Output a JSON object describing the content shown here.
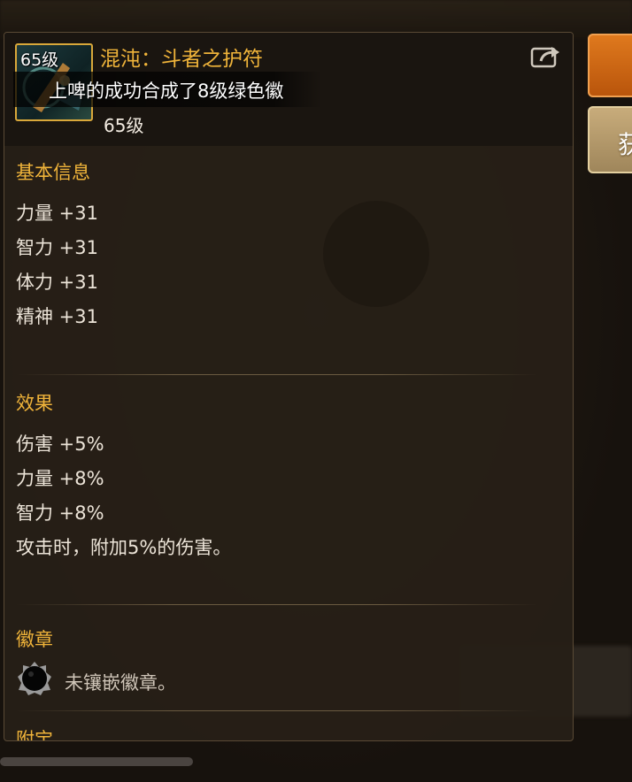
{
  "item": {
    "level_badge": "65级",
    "name": "混沌：斗者之护符",
    "level": "65级",
    "rarity_color": "#f0b43a"
  },
  "broadcast": {
    "text": "上啤的成功合成了8级绿色徽"
  },
  "sections": {
    "basic_info": {
      "title": "基本信息",
      "stats": [
        "力量 +31",
        "智力 +31",
        "体力 +31",
        "精神 +31"
      ]
    },
    "effects": {
      "title": "效果",
      "stats": [
        "伤害 +5%",
        "力量 +8%",
        "智力 +8%",
        "攻击时，附加5%的伤害。"
      ]
    },
    "badge": {
      "title": "徽章",
      "empty_text": "未镶嵌徽章。"
    },
    "next_title_partial": "附宝"
  },
  "side": {
    "gold_button_glyph": "获"
  },
  "icons": {
    "share": "share-icon",
    "badge_slot": "badge-slot-icon"
  }
}
